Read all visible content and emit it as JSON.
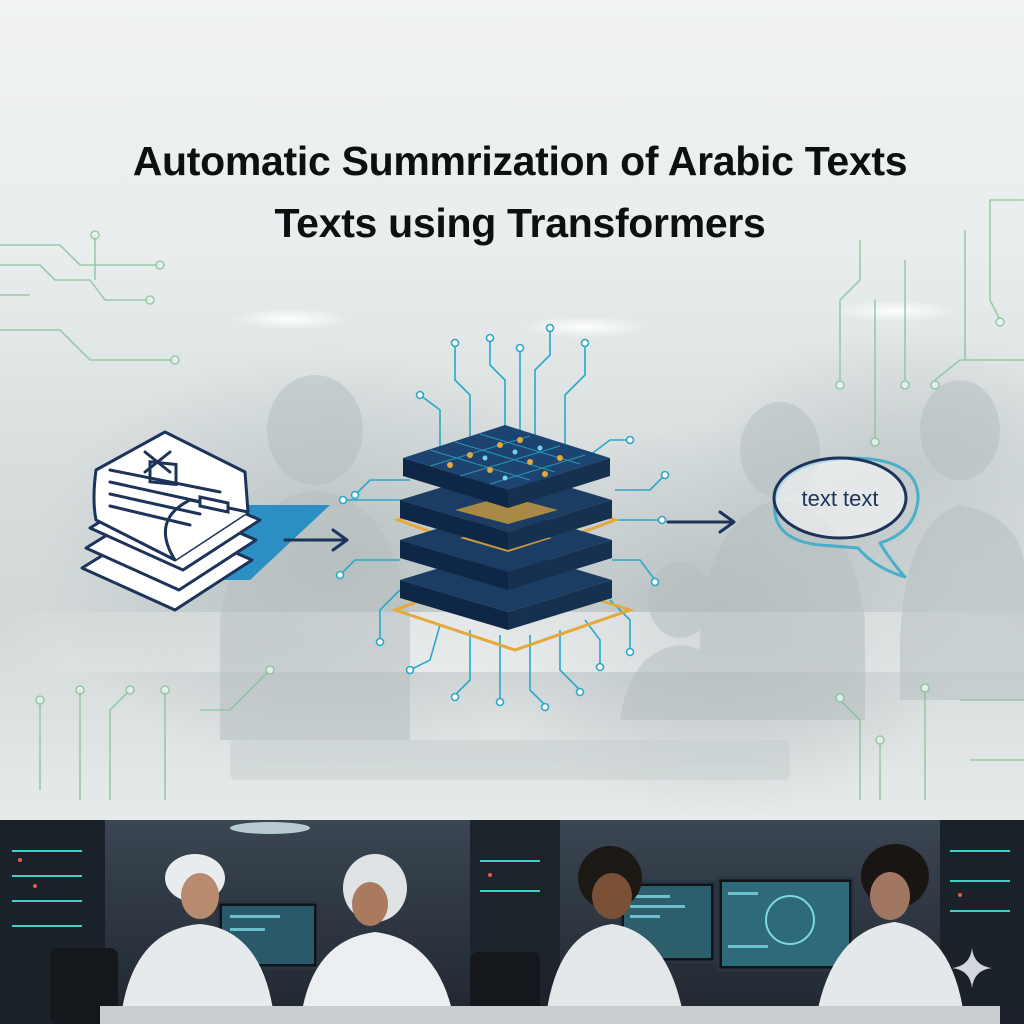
{
  "title": {
    "line1": "Automatic Summrization of Arabic Texts",
    "line2": "Texts using Transformers"
  },
  "summary_bubble": {
    "text": "text text"
  },
  "icons": {
    "input": "document-stack-icon",
    "arrow_in": "arrow-right-icon",
    "model": "transformer-chip-icon",
    "arrow_out": "arrow-right-icon",
    "output": "speech-bubble-icon",
    "watermark": "sparkle-icon"
  },
  "colors": {
    "title": "#0d0f11",
    "navy": "#1d3359",
    "chip_layer": "#17345a",
    "circuit_cyan": "#2aa8c8",
    "accent_orange": "#e4a93a",
    "circuit_green": "#86c49a"
  }
}
